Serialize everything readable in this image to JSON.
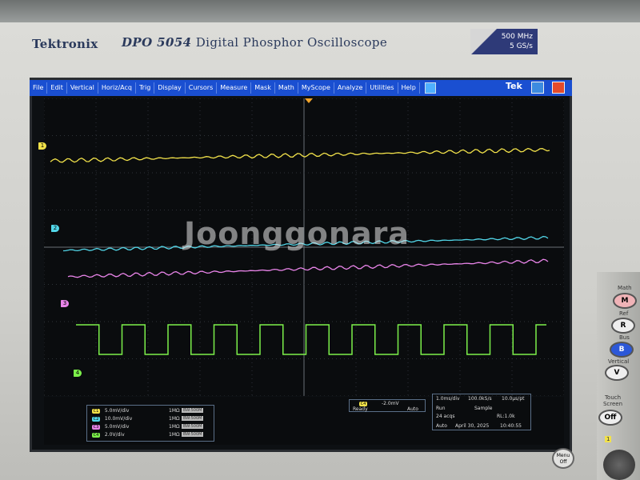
{
  "instrument": {
    "brand": "Tektronix",
    "model_number": "DPO 5054",
    "model_desc": "Digital Phosphor Oscilloscope",
    "spec_bw": "500 MHz",
    "spec_rate": "5 GS/s"
  },
  "menubar": {
    "items": [
      "File",
      "Edit",
      "Vertical",
      "Horiz/Acq",
      "Trig",
      "Display",
      "Cursors",
      "Measure",
      "Mask",
      "Math",
      "MyScope",
      "Analyze",
      "Utilities",
      "Help"
    ],
    "logo": "Tek"
  },
  "markers": [
    "1",
    "2",
    "3",
    "4"
  ],
  "channels": [
    {
      "badge": "C1",
      "scale": "5.0mV/div",
      "impedance": "1MΩ",
      "bw": "BW:500M",
      "color": "#f2e24a"
    },
    {
      "badge": "C2",
      "scale": "10.0mV/div",
      "impedance": "1MΩ",
      "bw": "BW:500M",
      "color": "#52d6e8"
    },
    {
      "badge": "C3",
      "scale": "5.0mV/div",
      "impedance": "1MΩ",
      "bw": "BW:500M",
      "color": "#e884e8"
    },
    {
      "badge": "C4",
      "scale": "2.0V/div",
      "impedance": "1MΩ",
      "bw": "BW:500M",
      "color": "#7cf04a"
    }
  ],
  "trigger": {
    "badge": "C4",
    "level": "-2.0mV",
    "state": "Ready",
    "mode": "Auto"
  },
  "acquisition": {
    "timebase": "1.0ms/div",
    "sample_rate": "100.0kS/s",
    "resolution": "10.0µs/pt",
    "run_state": "Run",
    "mode": "Sample",
    "record_length": "RL:1.0k",
    "acqs": "24 acqs",
    "trigger_mode": "Auto",
    "date": "April 30, 2025",
    "time": "10:40:55"
  },
  "panel": {
    "math_label": "Math",
    "math_btn": "M",
    "ref_label": "Ref",
    "ref_btn": "R",
    "bus_label": "Bus",
    "bus_btn": "B",
    "vertical_label": "Vertical",
    "vertical_btn": "V",
    "touch_label": "Touch Screen",
    "touch_btn": "Off",
    "menu_off": "Menu Off",
    "ch_num": "1"
  },
  "overlay": {
    "watermark": "Joonggonara"
  },
  "colors": {
    "menubar": "#1a4fd1",
    "ch1": "#f2e24a",
    "ch2": "#52d6e8",
    "ch3": "#e884e8",
    "ch4": "#7cf04a"
  }
}
